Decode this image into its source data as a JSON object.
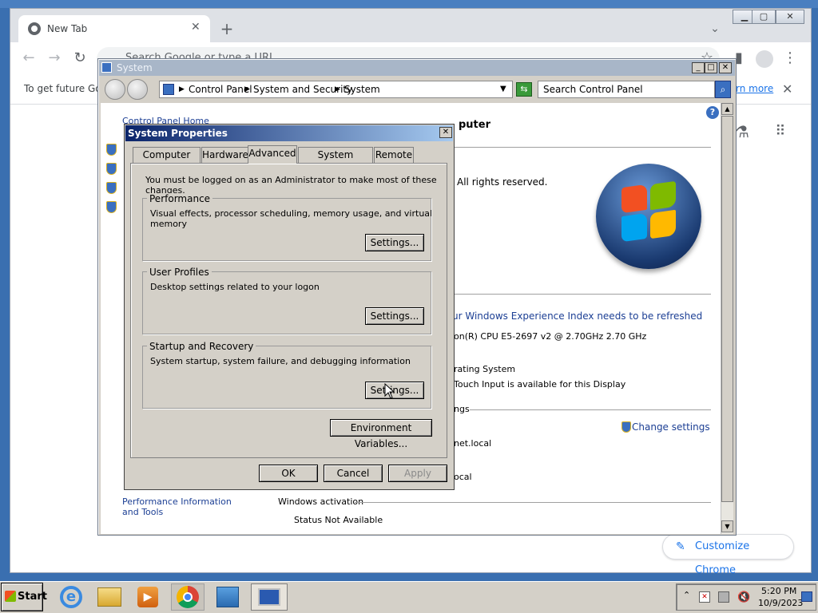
{
  "chrome": {
    "tab_title": "New Tab",
    "new_tab_symbol": "+",
    "omnibox_placeholder": "Search Google or type a URL",
    "infobar_text": "To get future Goo",
    "infobar_link": "rn more",
    "customize_label": "Customize Chrome"
  },
  "system_window": {
    "title": "System",
    "breadcrumb": [
      "Control Panel",
      "System and Security",
      "System"
    ],
    "search_placeholder": "Search Control Panel",
    "sidebar_home": "Control Panel Home",
    "heading_partial": "puter",
    "copyright_partial": "All rights reserved.",
    "experience_link": "ur Windows Experience Index needs to be refreshed",
    "processor_partial": "on(R) CPU E5-2697 v2 @ 2.70GHz   2.70 GHz",
    "system_type_partial": "rating System",
    "pen_partial": "Touch Input is available for this Display",
    "settings_section_partial": "ngs",
    "change_settings": "Change settings",
    "domain_partial_1": "net.local",
    "domain_partial_2": "ocal",
    "perf_link": "Performance Information and Tools",
    "activation_label": "Windows activation",
    "activation_status": "Status Not Available"
  },
  "dialog": {
    "title": "System Properties",
    "tabs": [
      "Computer Name",
      "Hardware",
      "Advanced",
      "System Protection",
      "Remote"
    ],
    "selected_tab": "Advanced",
    "admin_note": "You must be logged on as an Administrator to make most of these changes.",
    "performance": {
      "label": "Performance",
      "desc": "Visual effects, processor scheduling, memory usage, and virtual memory",
      "button": "Settings..."
    },
    "profiles": {
      "label": "User Profiles",
      "desc": "Desktop settings related to your logon",
      "button": "Settings..."
    },
    "startup": {
      "label": "Startup and Recovery",
      "desc": "System startup, system failure, and debugging information",
      "button": "Settings..."
    },
    "env_button": "Environment Variables...",
    "ok": "OK",
    "cancel": "Cancel",
    "apply": "Apply"
  },
  "taskbar": {
    "start_label": "Start",
    "time": "5:20 PM",
    "date": "10/9/2023"
  },
  "colors": {
    "link": "#1c3f94",
    "chrome_accent": "#1a73e8",
    "dialog_title_start": "#0a246a"
  }
}
